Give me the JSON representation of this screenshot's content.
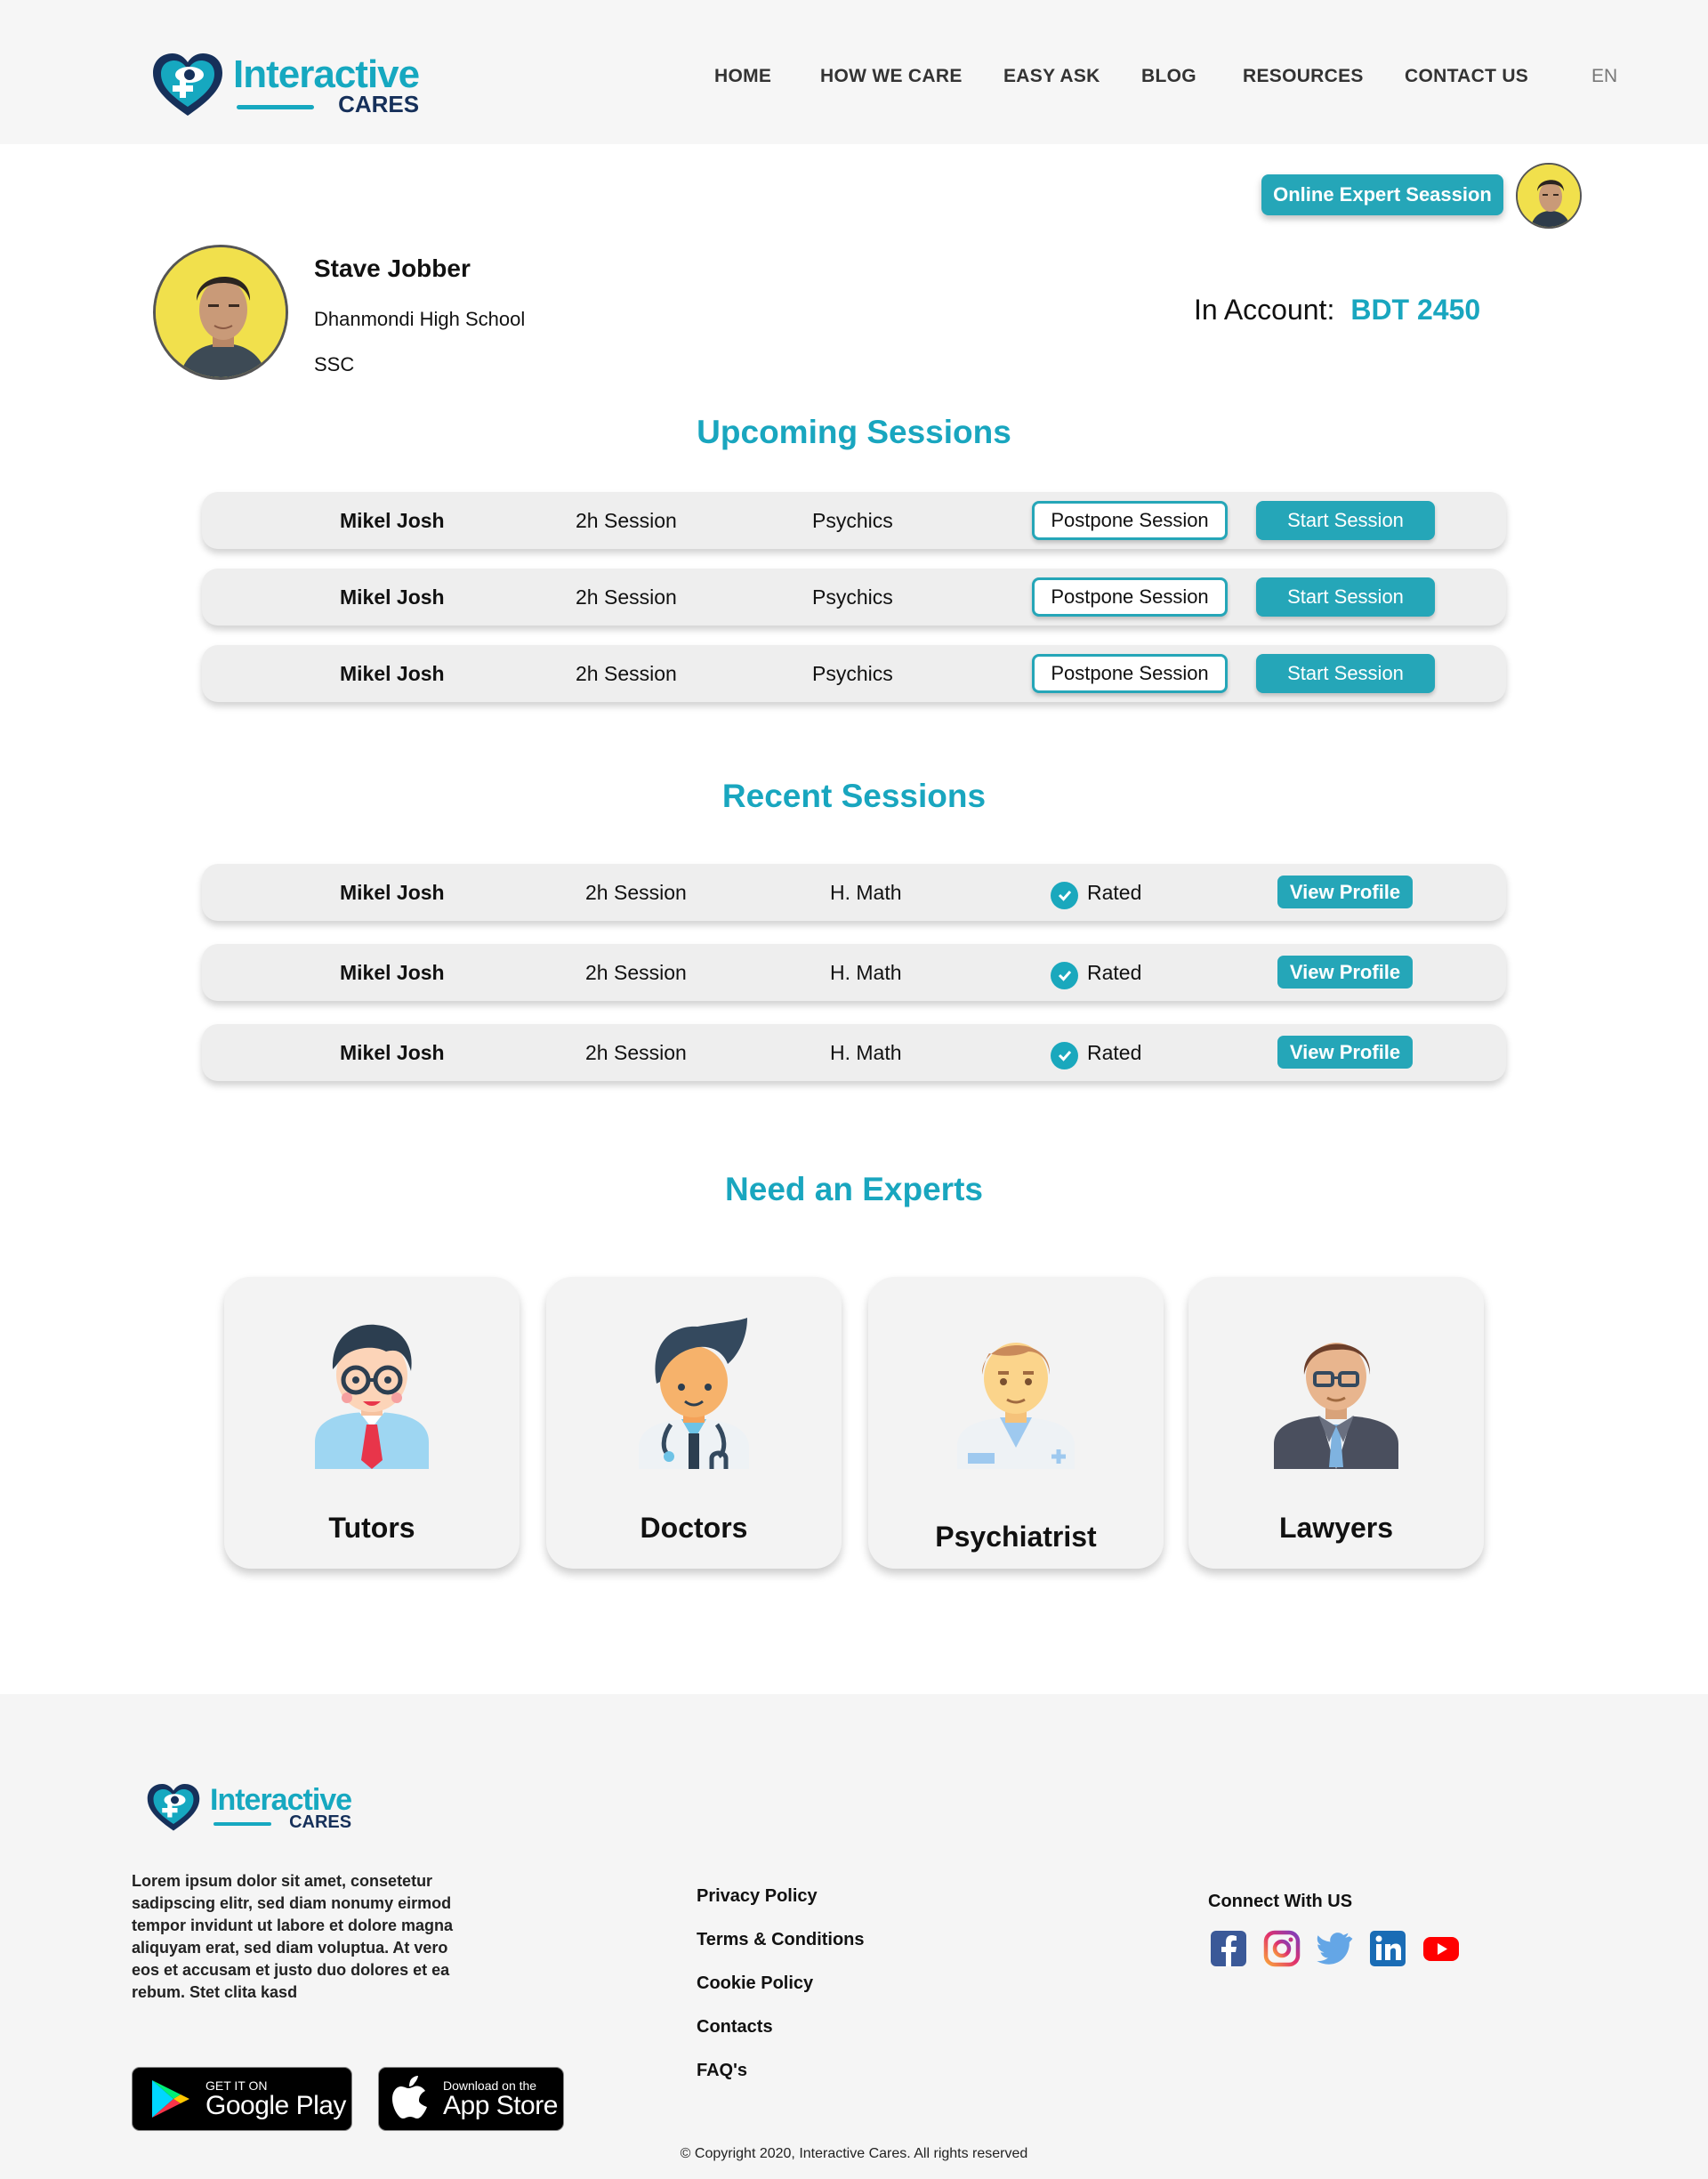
{
  "brand": {
    "name_line1": "Interactive",
    "name_line2": "CARES"
  },
  "nav": {
    "items": [
      "HOME",
      "HOW WE CARE",
      "EASY ASK",
      "BLOG",
      "RESOURCES",
      "CONTACT US"
    ],
    "lang": "EN"
  },
  "header_actions": {
    "online_session_label": "Online Expert Seassion"
  },
  "profile": {
    "name": "Stave Jobber",
    "school": "Dhanmondi High School",
    "level": "SSC",
    "account_label": "In Account:",
    "account_value": "BDT 2450"
  },
  "upcoming": {
    "title": "Upcoming Sessions",
    "rows": [
      {
        "expert": "Mikel Josh",
        "duration": "2h Session",
        "subject": "Psychics",
        "postpone": "Postpone Session",
        "start": "Start Session"
      },
      {
        "expert": "Mikel Josh",
        "duration": "2h Session",
        "subject": "Psychics",
        "postpone": "Postpone Session",
        "start": "Start Session"
      },
      {
        "expert": "Mikel Josh",
        "duration": "2h Session",
        "subject": "Psychics",
        "postpone": "Postpone Session",
        "start": "Start Session"
      }
    ]
  },
  "recent": {
    "title": "Recent Sessions",
    "rows": [
      {
        "expert": "Mikel Josh",
        "duration": "2h Session",
        "subject": "H. Math",
        "status": "Rated",
        "action": "View Profile"
      },
      {
        "expert": "Mikel Josh",
        "duration": "2h Session",
        "subject": "H. Math",
        "status": "Rated",
        "action": "View Profile"
      },
      {
        "expert": "Mikel Josh",
        "duration": "2h Session",
        "subject": "H. Math",
        "status": "Rated",
        "action": "View Profile"
      }
    ]
  },
  "experts": {
    "title": "Need an Experts",
    "cards": [
      {
        "label": "Tutors",
        "icon": "tutor-icon"
      },
      {
        "label": "Doctors",
        "icon": "doctor-icon"
      },
      {
        "label": "Psychiatrist",
        "icon": "psychiatrist-icon"
      },
      {
        "label": "Lawyers",
        "icon": "lawyer-icon"
      }
    ]
  },
  "footer": {
    "about": "Lorem ipsum dolor sit amet, consetetur sadipscing elitr, sed diam nonumy eirmod tempor invidunt ut labore et dolore magna aliquyam erat, sed diam voluptua. At vero eos et accusam et justo duo dolores et ea rebum. Stet clita kasd",
    "links": [
      "Privacy Policy",
      "Terms & Conditions",
      "Cookie Policy",
      "Contacts",
      "FAQ's"
    ],
    "connect_label": "Connect With US",
    "social": [
      "facebook-icon",
      "instagram-icon",
      "twitter-icon",
      "linkedin-icon",
      "youtube-icon"
    ],
    "google_play": {
      "small": "GET IT ON",
      "big": "Google Play"
    },
    "app_store": {
      "small": "Download on the",
      "big": "App Store"
    },
    "copyright": "© Copyright 2020, Interactive Cares. All rights reserved"
  },
  "colors": {
    "accent": "#19a6bf",
    "button": "#25a6b8",
    "navy": "#16305a",
    "row_bg": "#eeeeee"
  }
}
